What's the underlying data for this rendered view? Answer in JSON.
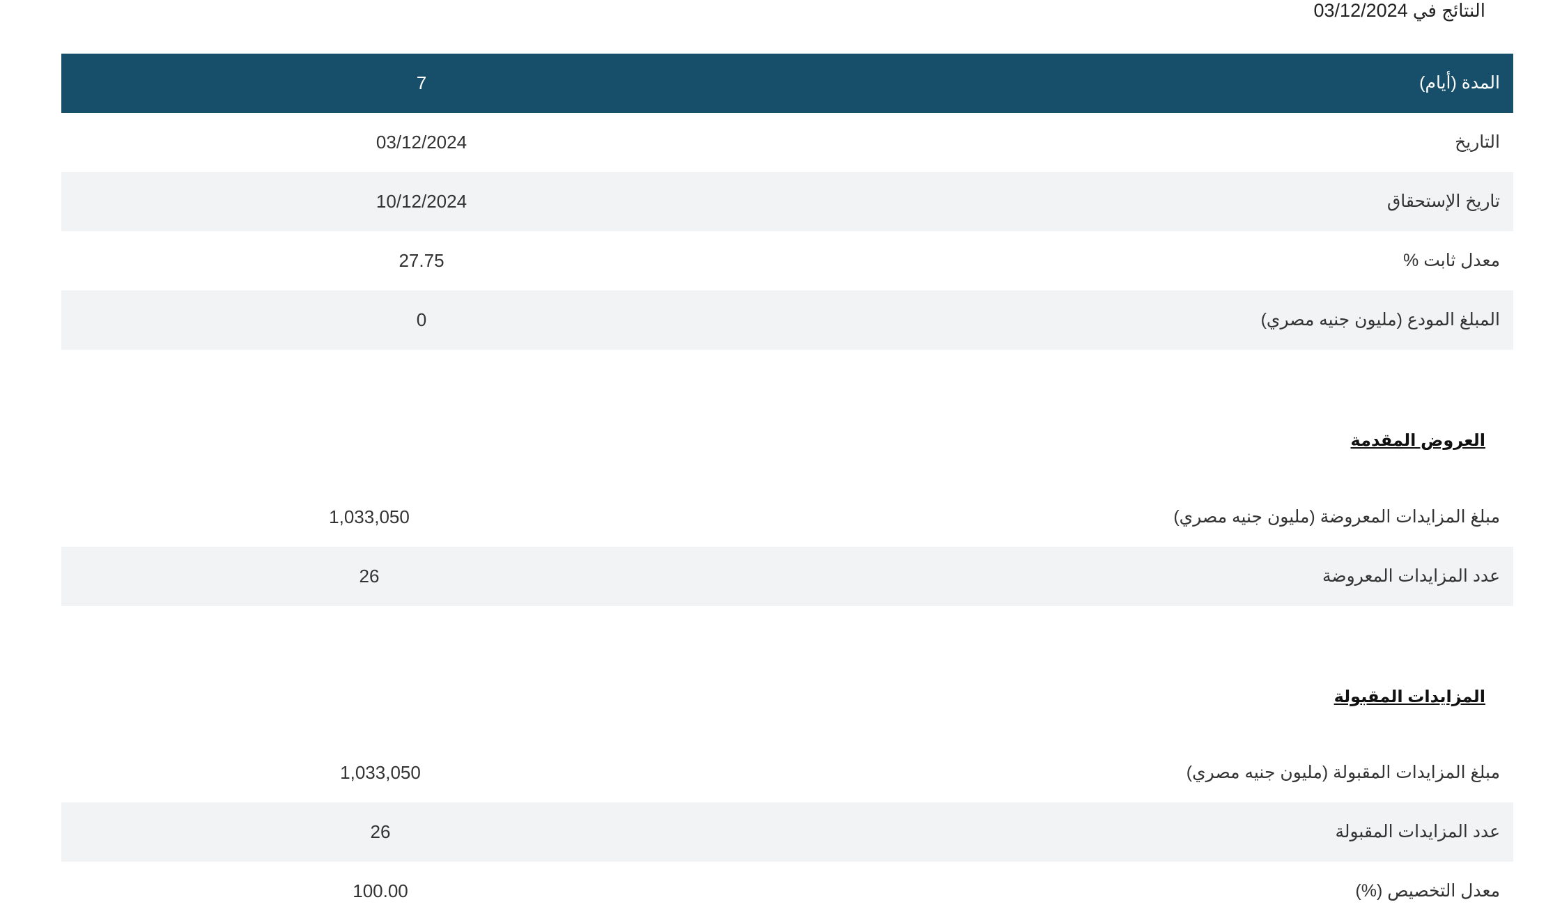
{
  "results_header": {
    "prefix": "النتائج في",
    "date": "03/12/2024"
  },
  "auction_table": {
    "rows": [
      {
        "label": "المدة (أيام)",
        "value": "7"
      },
      {
        "label": "التاريخ",
        "value": "03/12/2024"
      },
      {
        "label": "تاريخ الإستحقاق",
        "value": "10/12/2024"
      },
      {
        "label": "معدل ثابت %",
        "value": "27.75"
      },
      {
        "label": "المبلغ المودع (مليون جنيه مصري)",
        "value": "0"
      }
    ]
  },
  "offers_section": {
    "title": "العروض المقدمة",
    "rows": [
      {
        "label": "مبلغ المزايدات المعروضة (مليون جنيه مصري)",
        "value": "1,033,050"
      },
      {
        "label": "عدد المزايدات المعروضة",
        "value": "26"
      }
    ]
  },
  "accepted_section": {
    "title": "المزايدات المقبولة",
    "rows": [
      {
        "label": "مبلغ المزايدات المقبولة (مليون جنيه مصري)",
        "value": "1,033,050"
      },
      {
        "label": "عدد المزايدات المقبولة",
        "value": "26"
      },
      {
        "label": "معدل التخصيص (%)",
        "value": "100.00"
      }
    ]
  },
  "colors": {
    "header_bg": "#174f6a",
    "alt_row_bg": "#f2f3f4"
  }
}
